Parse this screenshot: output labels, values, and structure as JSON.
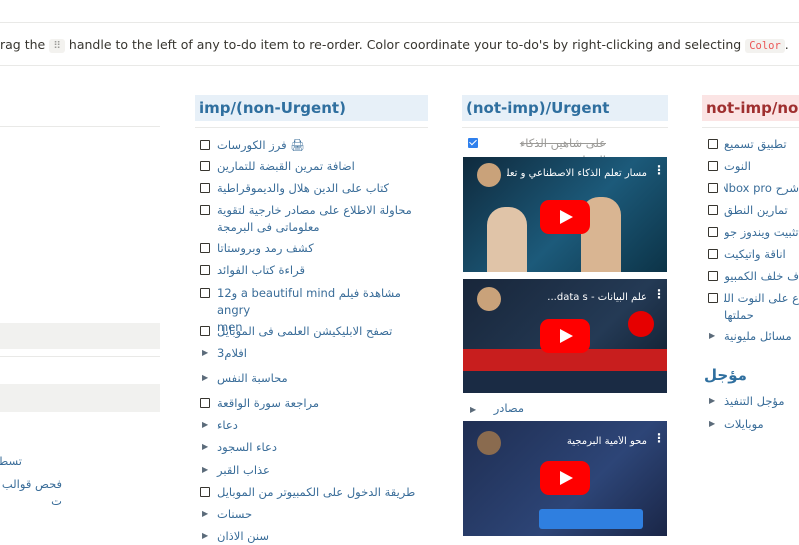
{
  "hint": {
    "before": "rag the",
    "handle_symbol": "⠿",
    "middle": "handle to the left of any to-do item to re-order. Color coordinate your to-do's by right-clicking and selecting",
    "code": "Color",
    "after": "."
  },
  "columns": {
    "imp_non_urgent": {
      "title": "imp/(non-Urgent)",
      "items": [
        {
          "text": "🖨 فرز الكورسات",
          "type": "checkbox"
        },
        {
          "text": "اضافة تمرين القبضة للتمارين",
          "type": "checkbox"
        },
        {
          "text": "كتاب على الدين هلال والديموقراطية",
          "type": "checkbox"
        },
        {
          "text": "محاولة الاطلاع على مصادر خارجية لتقوية",
          "text2": "معلوماتى فى البرمجة",
          "type": "checkbox"
        },
        {
          "text": "كشف رمد وبروستاتا",
          "type": "checkbox"
        },
        {
          "text": "قراءة كتاب الفوائد",
          "type": "checkbox"
        },
        {
          "text": "مشاهدة فيلم a beautiful mind و12 angry",
          "text2": "men",
          "type": "checkbox"
        },
        {
          "text": "تصفح الابليكيشن العلمى فى الموبايل",
          "type": "checkbox"
        },
        {
          "text": "افلام3",
          "type": "toggle"
        },
        {
          "text": "محاسبة النفس",
          "type": "toggle"
        },
        {
          "text": "مراجعة سورة الواقعة",
          "type": "checkbox"
        },
        {
          "text": "دعاء",
          "type": "toggle"
        },
        {
          "text": "دعاء السجود",
          "type": "toggle"
        },
        {
          "text": "عذاب القبر",
          "type": "toggle"
        },
        {
          "text": "طريقة الدخول على الكمبيوتر من الموبايل",
          "type": "checkbox"
        },
        {
          "text": "حسنات",
          "type": "toggle"
        },
        {
          "text": "سنن الاذان",
          "type": "toggle"
        }
      ]
    },
    "not_imp_urgent": {
      "title": "(not-imp)/Urgent",
      "checked_item": "على شاهين الذكاء الصناعى",
      "videos": [
        {
          "title": "مسار تعلم الذكاء الاصطناعي و تعلم الآلة"
        },
        {
          "title": "علم البيانات - data s..."
        },
        {
          "title": "محو الأمية البرمجية"
        }
      ],
      "toggle": "مصادر"
    },
    "not_imp_non_urgent": {
      "title": "not-imp/non-U",
      "items": [
        {
          "text": "تطبيق تسميع",
          "type": "checkbox"
        },
        {
          "text": "النوت",
          "type": "checkbox"
        },
        {
          "text": "شرح INbox pro",
          "type": "checkbox"
        },
        {
          "text": "تمارين النطق",
          "type": "checkbox"
        },
        {
          "text": "تثبيت ويندوز جو",
          "type": "checkbox"
        },
        {
          "text": "اناقة واتيكيت",
          "type": "checkbox"
        },
        {
          "text": "ف خلف الكمبيوتر",
          "type": "checkbox"
        },
        {
          "text": "ع على النوت اللى",
          "text2": "حملتها",
          "type": "checkbox"
        },
        {
          "text": "مسائل مليونية",
          "type": "toggle"
        }
      ],
      "postponed": {
        "title": "مؤجل",
        "items": [
          {
            "text": "مؤجل التنفيذ"
          },
          {
            "text": "موبايلات"
          }
        ]
      }
    }
  },
  "left_partial": {
    "text1": "تسط",
    "text2": "فحص قوالب ت"
  }
}
